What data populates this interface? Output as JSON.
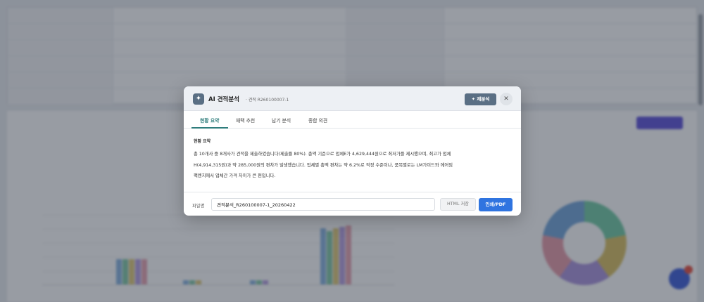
{
  "modal": {
    "logo_glyph": "✦",
    "title": "AI 견적분석",
    "subtitle": "· 견적 R260100007-1",
    "reanalyze_label": "✦ 재분석",
    "close_glyph": "✕",
    "tabs": [
      {
        "label": "현황 요약",
        "active": true
      },
      {
        "label": "채택 추천",
        "active": false
      },
      {
        "label": "납기 분석",
        "active": false
      },
      {
        "label": "종합 의견",
        "active": false
      }
    ],
    "section_title": "현황 요약",
    "summary_lines": [
      "총 10개사 중 8개사가 견적을 제출하였습니다(제출률 80%). 총액 기준으로 업체E가 4,629,444원으로 최저가를 제시했으며, 최고가 업체",
      "H(4,914,315원)과 약 285,000원의 편차가 발생했습니다. 업체별 총액 편차는 약 6.2%로 적정 수준이나, 품목별로는 LM가이드와 에어임",
      "팩렌치에서 업체간 가격 차이가 큰 편입니다."
    ],
    "footer": {
      "filename_label": "파일명",
      "filename_value": "견적분석_R260100007-1_20260422",
      "html_save_label": "HTML 저장",
      "print_label": "인쇄/PDF"
    }
  },
  "colors": {
    "accent_teal": "#2f7d7c",
    "header_slate": "#5a6f84",
    "primary_blue": "#2f74e0",
    "background_purple": "#5b4fd8"
  }
}
